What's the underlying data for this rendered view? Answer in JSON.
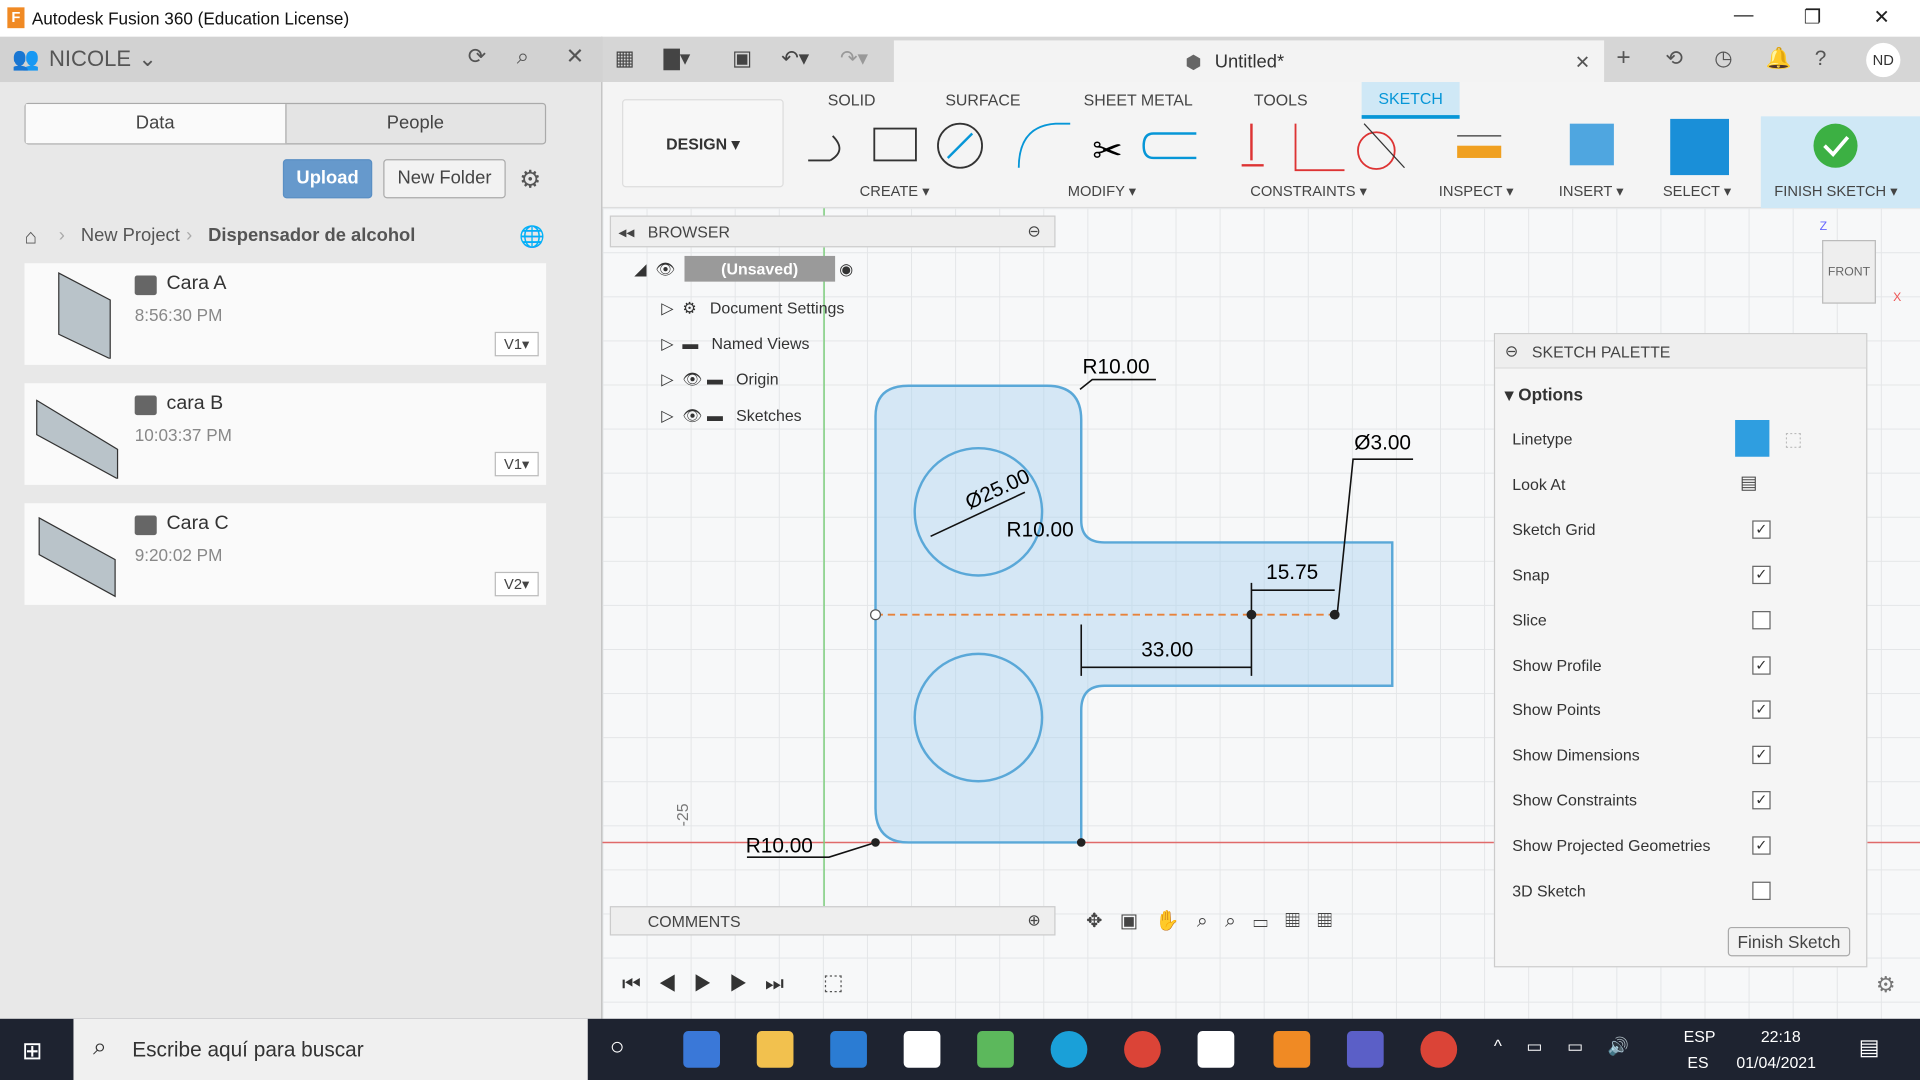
{
  "window": {
    "title": "Autodesk Fusion 360 (Education License)",
    "logo": "F"
  },
  "data_panel": {
    "user": "NICOLE",
    "tabs": [
      "Data",
      "People"
    ],
    "upload": "Upload",
    "new_folder": "New Folder",
    "breadcrumb": [
      "New Project",
      "Dispensador de alcohol"
    ],
    "items": [
      {
        "name": "Cara A",
        "time": "8:56:30 PM",
        "version": "V1"
      },
      {
        "name": "cara B",
        "time": "10:03:37 PM",
        "version": "V1"
      },
      {
        "name": "Cara C",
        "time": "9:20:02 PM",
        "version": "V2"
      }
    ]
  },
  "document": {
    "tab": "Untitled*",
    "user_initials": "ND"
  },
  "ribbon": {
    "workspace": "DESIGN",
    "tabs": [
      "SOLID",
      "SURFACE",
      "SHEET METAL",
      "TOOLS",
      "SKETCH"
    ],
    "active_tab": "SKETCH",
    "groups": [
      "CREATE",
      "MODIFY",
      "CONSTRAINTS",
      "INSPECT",
      "INSERT",
      "SELECT",
      "FINISH SKETCH"
    ]
  },
  "browser": {
    "title": "BROWSER",
    "root": "(Unsaved)",
    "items": [
      "Document Settings",
      "Named Views",
      "Origin",
      "Sketches"
    ]
  },
  "comments": {
    "title": "COMMENTS"
  },
  "viewcube": {
    "face": "FRONT",
    "axes": [
      "Z",
      "X"
    ]
  },
  "sketch": {
    "dims": [
      "R10.00",
      "Ø25.00",
      "R10.00",
      "Ø3.00",
      "15.75",
      "33.00",
      "R10.00",
      "-25"
    ]
  },
  "palette": {
    "title": "SKETCH PALETTE",
    "section": "Options",
    "rows": [
      {
        "label": "Linetype"
      },
      {
        "label": "Look At"
      },
      {
        "label": "Sketch Grid",
        "checked": true
      },
      {
        "label": "Snap",
        "checked": true
      },
      {
        "label": "Slice",
        "checked": false
      },
      {
        "label": "Show Profile",
        "checked": true
      },
      {
        "label": "Show Points",
        "checked": true
      },
      {
        "label": "Show Dimensions",
        "checked": true
      },
      {
        "label": "Show Constraints",
        "checked": true
      },
      {
        "label": "Show Projected Geometries",
        "checked": true
      },
      {
        "label": "3D Sketch",
        "checked": false
      }
    ],
    "finish": "Finish Sketch"
  },
  "taskbar": {
    "search": "Escribe aquí para buscar",
    "lang": "ESP",
    "lang2": "ES",
    "time": "22:18",
    "date": "01/04/2021"
  },
  "colors": {
    "accent": "#0696d7",
    "upload": "#6699cc",
    "sketch_line": "#5aa8d8"
  }
}
